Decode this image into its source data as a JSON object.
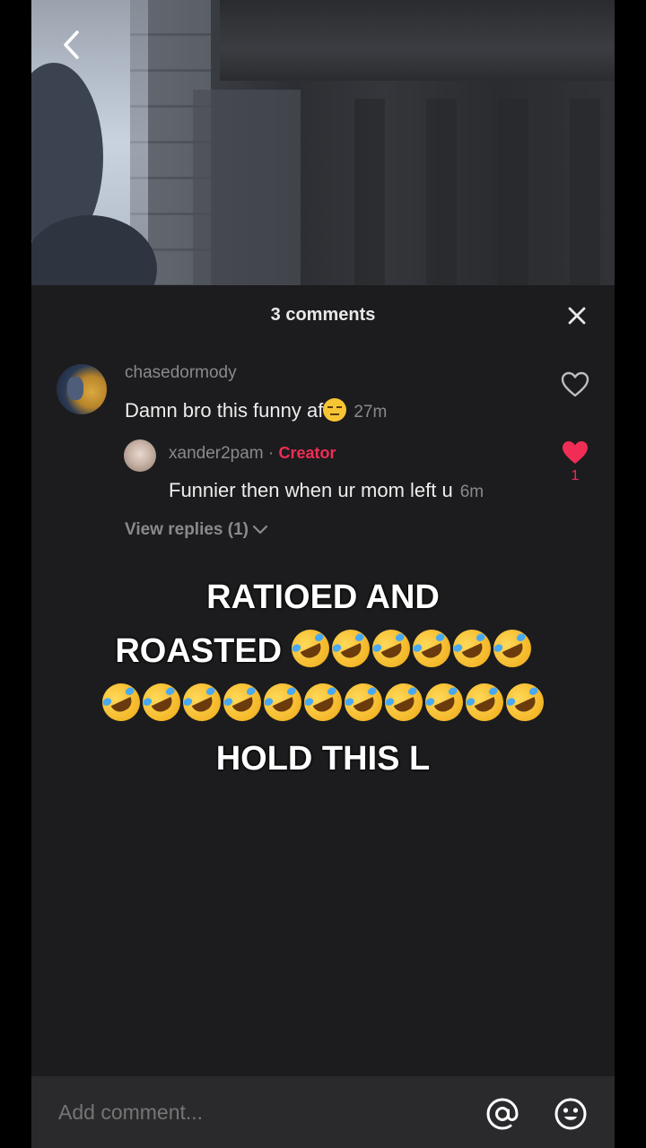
{
  "sheet": {
    "title": "3 comments"
  },
  "comments": [
    {
      "username": "chasedormody",
      "text": "Damn bro this funny af",
      "emoji_icon": "expressionless-face-emoji",
      "time": "27m",
      "liked": false
    }
  ],
  "reply": {
    "username": "xander2pam",
    "separator": "·",
    "badge": "Creator",
    "text": "Funnier then when ur mom left u",
    "time": "6m",
    "liked": true,
    "like_count": "1"
  },
  "view_replies": "View replies (1)",
  "caption": {
    "line1": "RATIOED AND",
    "line2": "ROASTED",
    "line4": "HOLD THIS L",
    "emoji_icon": "rolling-on-floor-laughing-emoji"
  },
  "composer": {
    "placeholder": "Add comment..."
  },
  "colors": {
    "accent": "#ef2d55",
    "sheet_bg": "#1c1c1e"
  }
}
